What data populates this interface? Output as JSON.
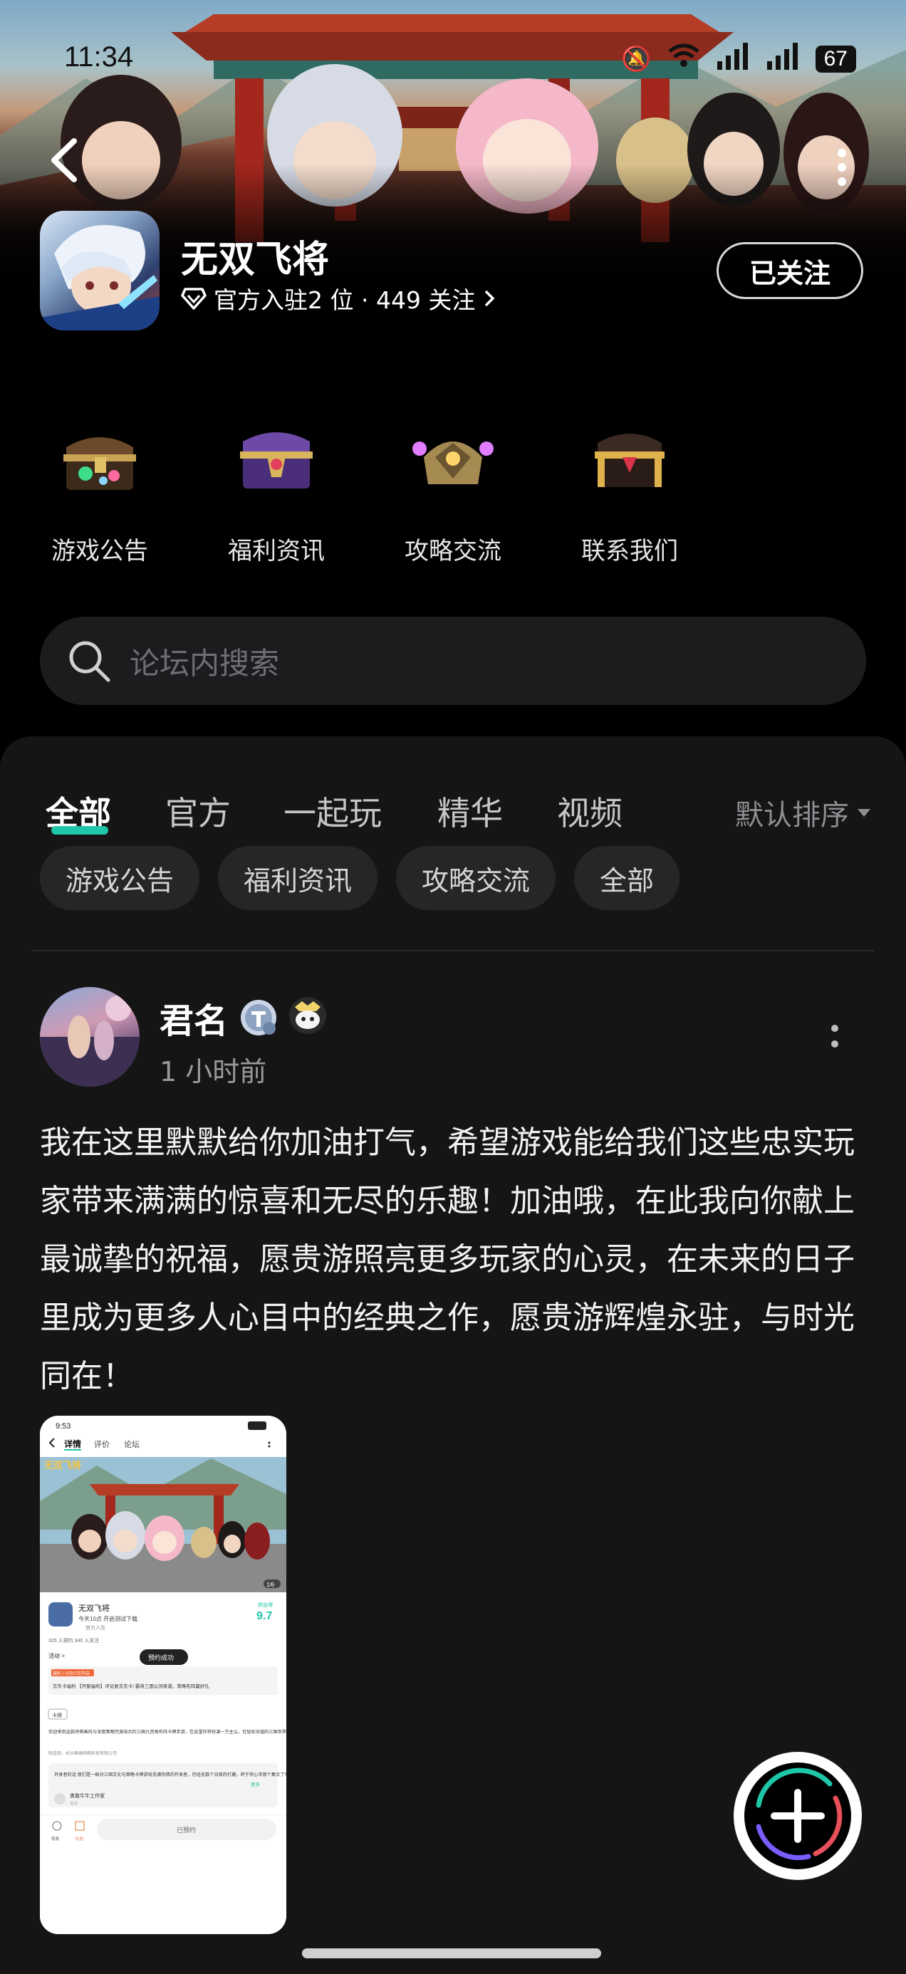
{
  "status_bar": {
    "time": "11:34",
    "battery": "67",
    "network_1": "5G",
    "network_2": "5G"
  },
  "header": {
    "game_title": "无双飞将",
    "sub_text": "官方入驻2 位 · 449 关注",
    "follow_label": "已关注"
  },
  "quick_entries": [
    {
      "label": "游戏公告",
      "icon": "treasure-chest-green-icon"
    },
    {
      "label": "福利资讯",
      "icon": "treasure-chest-purple-icon"
    },
    {
      "label": "攻略交流",
      "icon": "helmet-chest-icon"
    },
    {
      "label": "联系我们",
      "icon": "treasure-chest-gold-icon"
    }
  ],
  "search": {
    "placeholder": "论坛内搜索"
  },
  "tabs": [
    "全部",
    "官方",
    "一起玩",
    "精华",
    "视频"
  ],
  "active_tab": "全部",
  "sort_label": "默认排序",
  "chips": [
    "游戏公告",
    "福利资讯",
    "攻略交流",
    "全部"
  ],
  "post": {
    "user_name": "君名",
    "time": "1 小时前",
    "text": "我在这里默默给你加油打气，希望游戏能给我们这些忠实玩家带来满满的惊喜和无尽的乐趣！加油哦，在此我向你献上最诚挚的祝福，愿贵游照亮更多玩家的心灵，在未来的日子里成为更多人心目中的经典之作，愿贵游辉煌永驻，与时光同在！"
  },
  "screenshot": {
    "time": "9:53",
    "tabs": [
      "详情",
      "评价",
      "论坛"
    ],
    "banner_logo": "无双飞将",
    "page_indicator": "1/6",
    "app_name": "无双飞将",
    "app_desc": "今天10点 开启测试下载",
    "app_official": "官方入驻",
    "score_label": "预告得",
    "score": "9.7",
    "stats": "325 人预约    340 人关注",
    "activity": "活动 >",
    "toast": "预约成功",
    "promo_tag": "福利丨6月07日开启",
    "promo_text": "京东卡福利 【开服福利】评论复京东卡! 霸将三国公测来袭，策略布阵赢好礼",
    "tag": "卡牌",
    "intro": "欢迎来到这款将萌画风与深度策略完美结合的三国九宫格布阵卡牌手游，在这里你将扮演一方主公，在轻松诙谐的三国世界中，收集上百位造型独特、性格鲜明的Q版武将卡牌，并通过精湛的养成体系强化你...",
    "developer": "制造商：长沙雍乘网络科技有限公司",
    "dev_note": "开发者的话  我们是一群对三国文化与策略卡牌游戏充满热情的开发者，历经无数个日夜的打磨，终于将心中那个集合了可...",
    "more": "更多",
    "studio": "勇敢牛牛工作室",
    "studio_sub": "关注",
    "bottom_left_1": "客服",
    "bottom_left_2": "礼包",
    "booked": "已预约"
  },
  "fab_icon": "plus-icon",
  "colors": {
    "accent": "#1fc6a8",
    "background": "#000000",
    "sheet": "#151515",
    "chip": "#262628"
  }
}
